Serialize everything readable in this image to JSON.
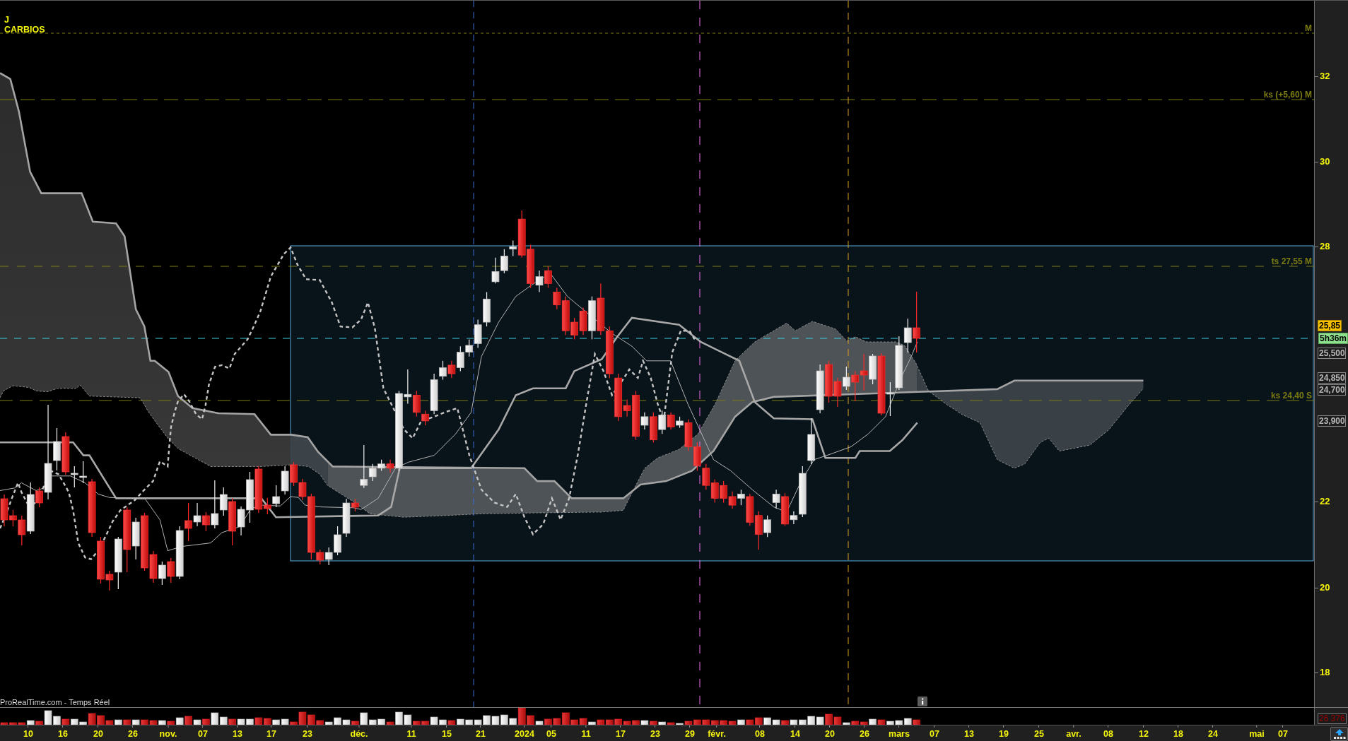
{
  "instrument": {
    "timeframe": "J",
    "name": "CARBIOS"
  },
  "level_lines": [
    {
      "label": "M"
    },
    {
      "label": "ks (+5,60) M"
    },
    {
      "label": "ts 27,55 M"
    },
    {
      "label": "ks 24,40 S"
    }
  ],
  "price_axis": {
    "labels": [
      "32",
      "30",
      "28",
      "22",
      "20",
      "18"
    ]
  },
  "price_markers": [
    {
      "kind": "last",
      "text": "25,85"
    },
    {
      "kind": "countdown",
      "text": "5h36m"
    },
    {
      "kind": "level",
      "text": "25,500"
    },
    {
      "kind": "level",
      "text": "24,850"
    },
    {
      "kind": "level",
      "text": "24,700"
    },
    {
      "kind": "level",
      "text": "23,900"
    }
  ],
  "source_label": "ProRealTime.com - Temps Réel",
  "volume_axis": {
    "label": "26 376"
  },
  "time_axis": {
    "labels": [
      "10",
      "16",
      "20",
      "26",
      "nov.",
      "07",
      "13",
      "17",
      "23",
      "déc.",
      "11",
      "15",
      "21",
      "2024",
      "05",
      "11",
      "17",
      "23",
      "29",
      "févr.",
      "08",
      "14",
      "20",
      "26",
      "mars",
      "07",
      "13",
      "19",
      "25",
      "avr.",
      "08",
      "12",
      "18",
      "24",
      "mai",
      "07"
    ]
  }
}
